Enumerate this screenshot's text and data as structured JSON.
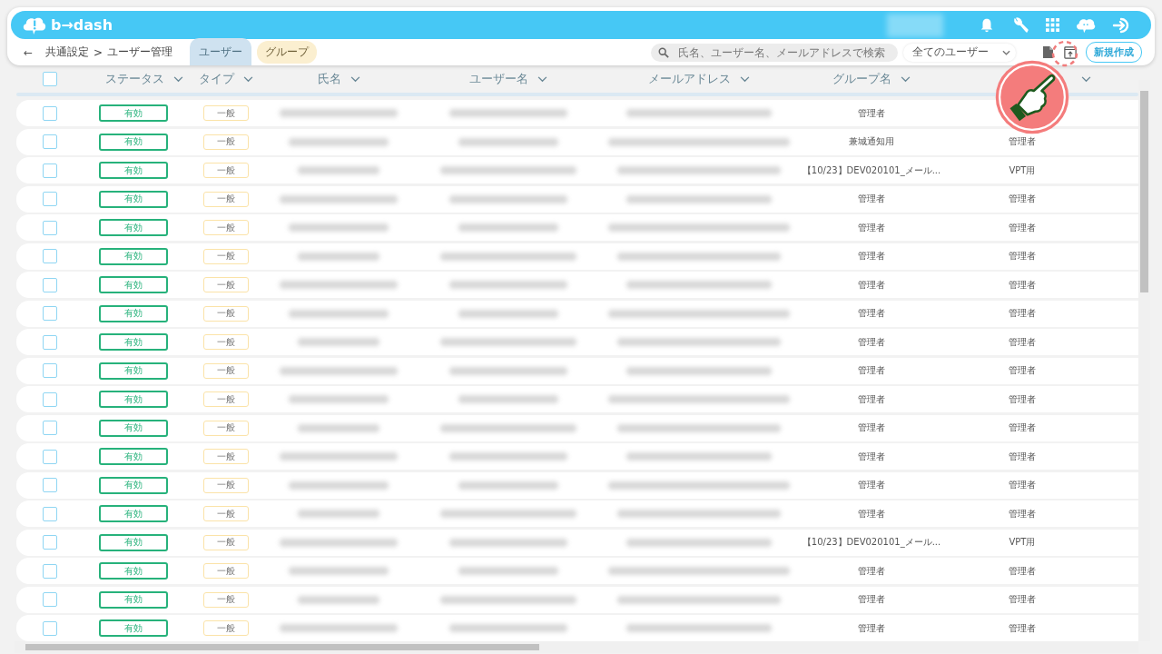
{
  "header": {
    "logo": "b→dash"
  },
  "breadcrumb": {
    "back": "←",
    "items": [
      "共通設定",
      ">",
      "ユーザー管理"
    ]
  },
  "tabs": [
    {
      "label": "ユーザー",
      "selected": true
    },
    {
      "label": "グループ",
      "selected": false
    }
  ],
  "search": {
    "placeholder": "氏名、ユーザー名、メールアドレスで検索"
  },
  "filter": {
    "value": "全てのユーザー"
  },
  "new_button": "新規作成",
  "select_all": {
    "checked": false
  },
  "columns": [
    {
      "label": "ステータス"
    },
    {
      "label": "タイプ"
    },
    {
      "label": "氏名"
    },
    {
      "label": "ユーザー名"
    },
    {
      "label": "メールアドレス"
    },
    {
      "label": "グループ名"
    },
    {}
  ],
  "rows": [
    {
      "checked": false,
      "status": "有効",
      "type": "一般",
      "group": "管理者"
    },
    {
      "checked": false,
      "status": "有効",
      "type": "一般",
      "group": "兼城通知用",
      "role": "管理者"
    },
    {
      "checked": false,
      "status": "有効",
      "type": "一般",
      "group": "【10/23】DEV020101_メール...",
      "role": "VPT用"
    },
    {
      "checked": false,
      "status": "有効",
      "type": "一般",
      "group": "管理者",
      "role": "管理者"
    },
    {
      "checked": false,
      "status": "有効",
      "type": "一般",
      "group": "管理者",
      "role": "管理者"
    },
    {
      "checked": false,
      "status": "有効",
      "type": "一般",
      "group": "管理者",
      "role": "管理者"
    },
    {
      "checked": false,
      "status": "有効",
      "type": "一般",
      "group": "管理者",
      "role": "管理者"
    },
    {
      "checked": false,
      "status": "有効",
      "type": "一般",
      "group": "管理者",
      "role": "管理者"
    },
    {
      "checked": false,
      "status": "有効",
      "type": "一般",
      "group": "管理者",
      "role": "管理者"
    },
    {
      "checked": false,
      "status": "有効",
      "type": "一般",
      "group": "管理者",
      "role": "管理者"
    },
    {
      "checked": false,
      "status": "有効",
      "type": "一般",
      "group": "管理者",
      "role": "管理者"
    },
    {
      "checked": false,
      "status": "有効",
      "type": "一般",
      "group": "管理者",
      "role": "管理者"
    },
    {
      "checked": false,
      "status": "有効",
      "type": "一般",
      "group": "管理者",
      "role": "管理者"
    },
    {
      "checked": false,
      "status": "有効",
      "type": "一般",
      "group": "管理者",
      "role": "管理者"
    },
    {
      "checked": false,
      "status": "有効",
      "type": "一般",
      "group": "管理者",
      "role": "管理者"
    },
    {
      "checked": false,
      "status": "有効",
      "type": "一般",
      "group": "【10/23】DEV020101_メール...",
      "role": "VPT用"
    },
    {
      "checked": false,
      "status": "有効",
      "type": "一般",
      "group": "管理者",
      "role": "管理者"
    },
    {
      "checked": false,
      "status": "有効",
      "type": "一般",
      "group": "管理者",
      "role": "管理者"
    },
    {
      "checked": false,
      "status": "有効",
      "type": "一般",
      "group": "管理者",
      "role": "管理者"
    }
  ]
}
